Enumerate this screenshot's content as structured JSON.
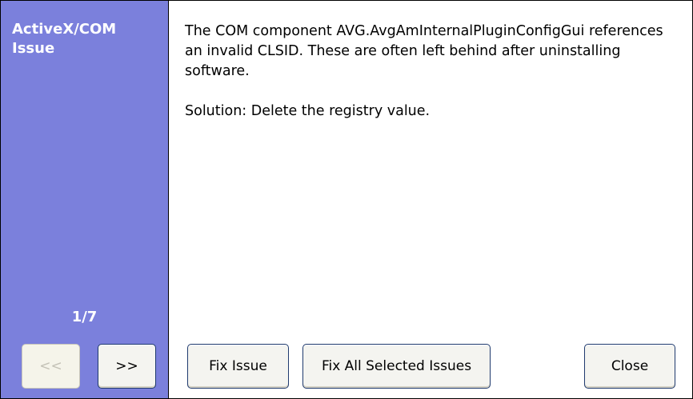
{
  "sidebar": {
    "title": "ActiveX/COM Issue",
    "page_counter": "1/7",
    "prev_label": "<<",
    "next_label": ">>",
    "color": "#7b80dc"
  },
  "content": {
    "description": "The COM component AVG.AvgAmInternalPluginConfigGui references an invalid CLSID. These are often left behind after uninstalling software.",
    "solution": "Solution: Delete the registry value."
  },
  "buttons": {
    "fix_issue": "Fix Issue",
    "fix_all": "Fix All Selected Issues",
    "close": "Close"
  }
}
